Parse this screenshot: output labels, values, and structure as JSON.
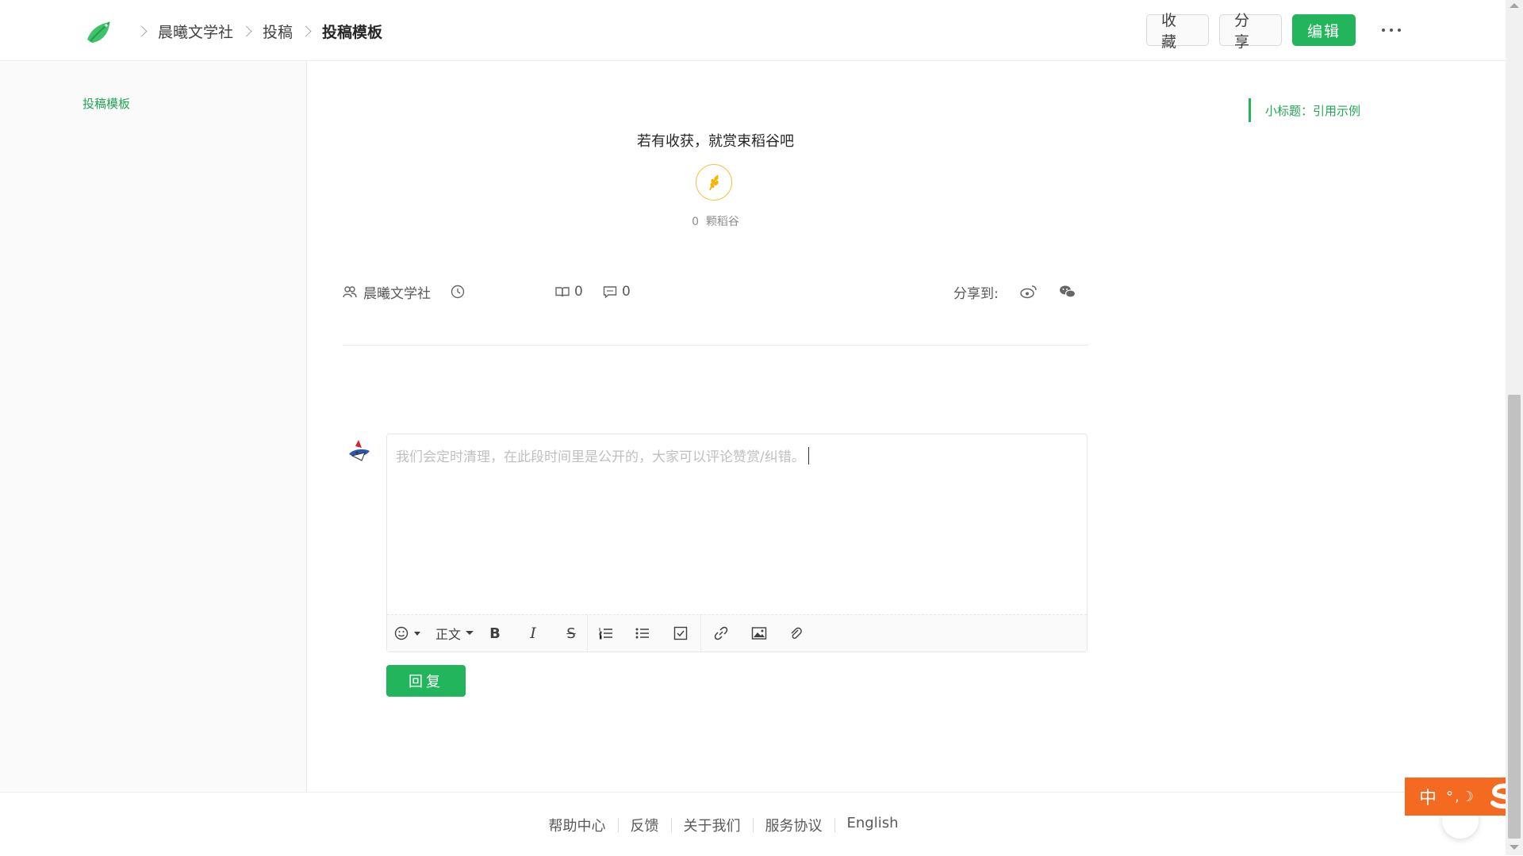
{
  "breadcrumb": {
    "items": [
      "晨曦文学社",
      "投稿",
      "投稿模板"
    ]
  },
  "top_actions": {
    "favorite": "收藏",
    "share": "分享",
    "edit": "编辑"
  },
  "sidebar": {
    "items": [
      {
        "label": "投稿模板"
      }
    ]
  },
  "toc": {
    "items": [
      {
        "label": "小标题：引用示例"
      }
    ]
  },
  "reward": {
    "title": "若有收获，就赏束稻谷吧",
    "count": "0",
    "unit": "颗稻谷"
  },
  "meta": {
    "author": "晨曦文学社",
    "reads": "0",
    "comments": "0",
    "share_label": "分享到:"
  },
  "comment": {
    "placeholder": "我们会定时清理，在此段时间里是公开的，大家可以评论赞赏/纠错。",
    "heading_select": "正文",
    "reply_button": "回复"
  },
  "footer": {
    "links": [
      "帮助中心",
      "反馈",
      "关于我们",
      "服务协议",
      "English"
    ]
  },
  "ime": {
    "mode": "中",
    "punct": "°,☽"
  },
  "colors": {
    "accent": "#22b55b",
    "reward": "#f5c242",
    "ime": "#f36a20"
  }
}
